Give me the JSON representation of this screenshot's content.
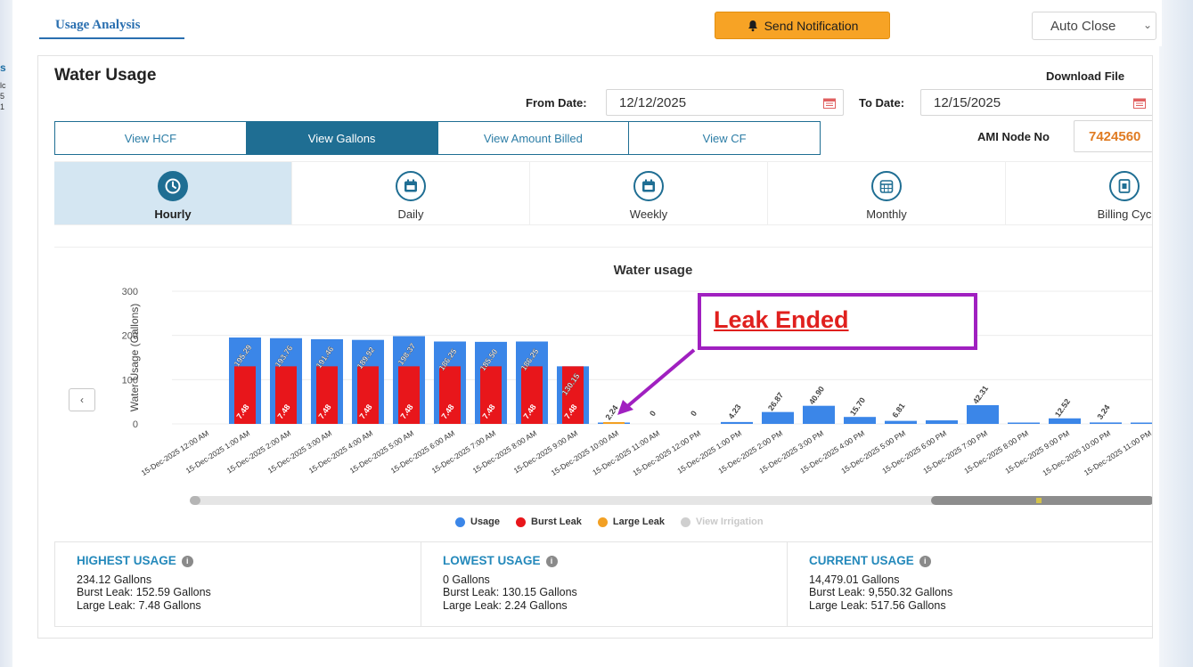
{
  "left_strip": {
    "head": "s",
    "lines": [
      "lc",
      "5",
      "1"
    ]
  },
  "tabs": {
    "usage_analysis": "Usage Analysis"
  },
  "toolbar": {
    "send_notification": "Send Notification",
    "auto_close": "Auto Close"
  },
  "panel": {
    "title": "Water Usage",
    "download": "Download File",
    "from_label": "From Date:",
    "from_value": "12/12/2025",
    "to_label": "To Date:",
    "to_value": "12/15/2025",
    "ami_label": "AMI Node No",
    "ami_value": "7424560"
  },
  "view_tabs": [
    {
      "label": "View HCF",
      "active": false
    },
    {
      "label": "View Gallons",
      "active": true
    },
    {
      "label": "View Amount Billed",
      "active": false
    },
    {
      "label": "View CF",
      "active": false
    }
  ],
  "periods": [
    {
      "label": "Hourly",
      "icon": "clock-icon",
      "active": true
    },
    {
      "label": "Daily",
      "icon": "calendar-icon",
      "active": false
    },
    {
      "label": "Weekly",
      "icon": "calendar-icon",
      "active": false
    },
    {
      "label": "Monthly",
      "icon": "calendar-grid-icon",
      "active": false
    },
    {
      "label": "Billing Cyc",
      "icon": "bill-icon",
      "active": false
    }
  ],
  "annotation": {
    "text": "Leak Ended",
    "color": "#e0201e",
    "box_color": "#a020c0"
  },
  "colors": {
    "usage": "#3b86e8",
    "burst_leak": "#e8161b",
    "large_leak": "#f2a024",
    "irrigation": "#cfcfcf",
    "accent": "#1f6e93"
  },
  "chart_data": {
    "type": "bar",
    "title": "Water usage",
    "ylabel": "Water Usage (Gallons)",
    "ylim": [
      0,
      300
    ],
    "yticks": [
      0,
      100,
      200,
      300
    ],
    "categories": [
      "15-Dec-2025 12:00 AM",
      "15-Dec-2025 1:00 AM",
      "15-Dec-2025 2:00 AM",
      "15-Dec-2025 3:00 AM",
      "15-Dec-2025 4:00 AM",
      "15-Dec-2025 5:00 AM",
      "15-Dec-2025 6:00 AM",
      "15-Dec-2025 7:00 AM",
      "15-Dec-2025 8:00 AM",
      "15-Dec-2025 9:00 AM",
      "15-Dec-2025 10:00 AM",
      "15-Dec-2025 11:00 AM",
      "15-Dec-2025 12:00 PM",
      "15-Dec-2025 1:00 PM",
      "15-Dec-2025 2:00 PM",
      "15-Dec-2025 3:00 PM",
      "15-Dec-2025 4:00 PM",
      "15-Dec-2025 5:00 PM",
      "15-Dec-2025 6:00 PM",
      "15-Dec-2025 7:00 PM",
      "15-Dec-2025 8:00 PM",
      "15-Dec-2025 9:00 PM",
      "15-Dec-2025 10:00 PM",
      "15-Dec-2025 11:00 PM"
    ],
    "series": [
      {
        "name": "Usage",
        "values": [
          null,
          195.29,
          193.76,
          191.46,
          189.92,
          198.37,
          186.25,
          185.5,
          186.25,
          130.15,
          2.24,
          0,
          0,
          4.23,
          26.87,
          40.9,
          15.7,
          6.81,
          8,
          42.31,
          1,
          12.52,
          3.24,
          2
        ]
      },
      {
        "name": "Burst Leak",
        "values": [
          null,
          130.15,
          130.15,
          130.15,
          130.15,
          130.15,
          130.15,
          130.15,
          130.15,
          130.15,
          null,
          null,
          null,
          null,
          null,
          null,
          null,
          null,
          null,
          null,
          null,
          null,
          null,
          null
        ]
      },
      {
        "name": "Large Leak",
        "values": [
          null,
          7.48,
          7.48,
          7.48,
          7.48,
          7.48,
          7.48,
          7.48,
          7.48,
          7.48,
          2.24,
          null,
          null,
          null,
          null,
          null,
          null,
          null,
          null,
          null,
          null,
          null,
          null,
          null
        ]
      }
    ],
    "usage_labels": [
      "",
      "195.29",
      "193.76",
      "191.46",
      "189.92",
      "198.37",
      "186.25",
      "185.50",
      "186.25",
      "130.15",
      "2.24",
      "0",
      "0",
      "4.23",
      "26.87",
      "40.90",
      "15.70",
      "6.81",
      "",
      "42.31",
      "",
      "12.52",
      "3.24",
      ""
    ],
    "large_leak_labels": [
      "",
      "7.48",
      "7.48",
      "7.48",
      "7.48",
      "7.48",
      "7.48",
      "7.48",
      "7.48",
      "7.48",
      "",
      "",
      "",
      "",
      "",
      "",
      "",
      "",
      "",
      "",
      "",
      "",
      "",
      ""
    ],
    "legend": [
      "Usage",
      "Burst Leak",
      "Large Leak",
      "View Irrigation"
    ],
    "legend_position": "bottom"
  },
  "stats": [
    {
      "title": "HIGHEST USAGE",
      "value": "234.12 Gallons",
      "burst": "Burst Leak: 152.59 Gallons",
      "large": "Large Leak: 7.48 Gallons"
    },
    {
      "title": "LOWEST USAGE",
      "value": "0 Gallons",
      "burst": "Burst Leak: 130.15 Gallons",
      "large": "Large Leak: 2.24 Gallons"
    },
    {
      "title": "CURRENT USAGE",
      "value": "14,479.01 Gallons",
      "burst": "Burst Leak: 9,550.32 Gallons",
      "large": "Large Leak: 517.56 Gallons"
    }
  ]
}
